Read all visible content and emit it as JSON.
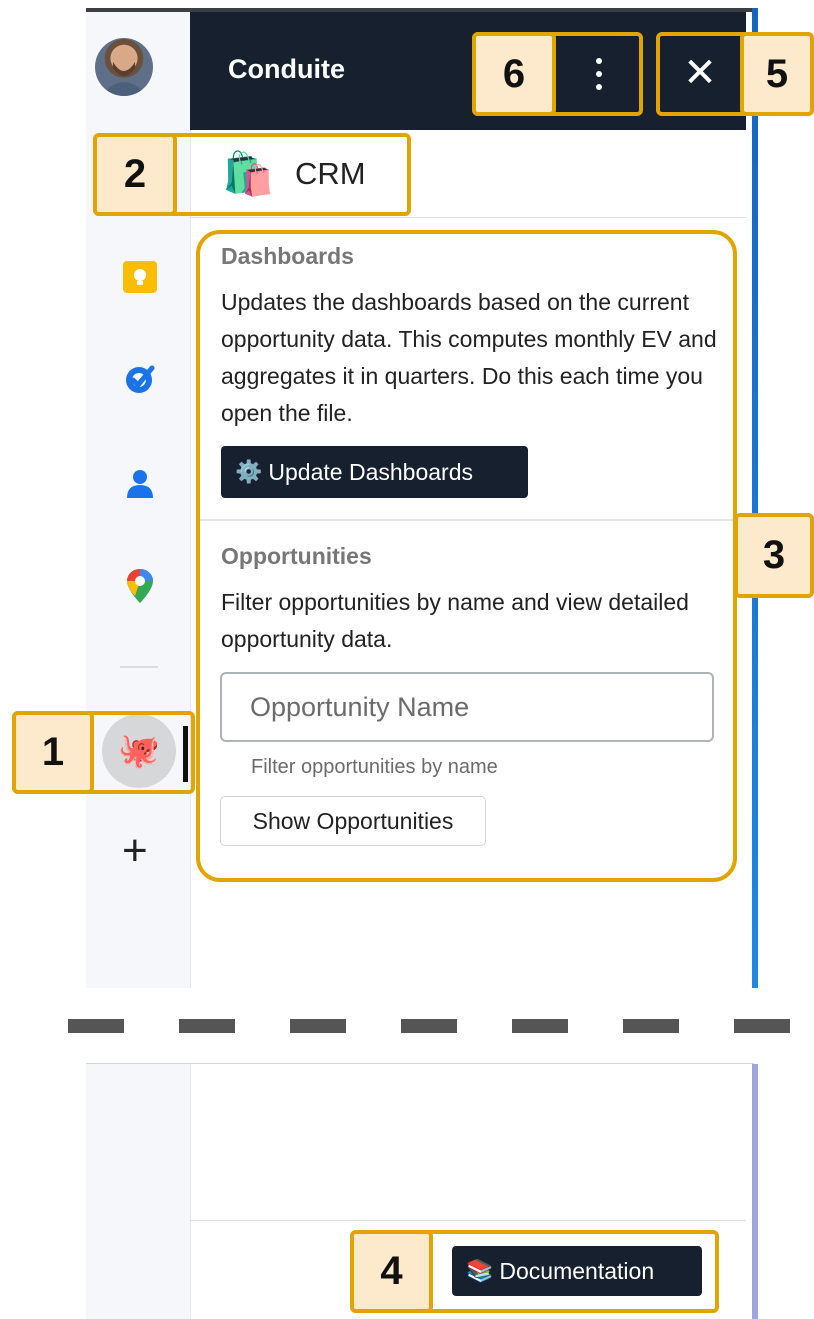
{
  "header": {
    "title": "Conduite",
    "menu_icon": "vertical-ellipsis-icon",
    "close_icon": "close-icon",
    "close_glyph": "✕"
  },
  "rail": {
    "avatar_icon": "user-avatar",
    "items": [
      {
        "name": "keep-icon",
        "color": "#fbbc04"
      },
      {
        "name": "tasks-icon",
        "color": "#1a73e8"
      },
      {
        "name": "contacts-icon",
        "color": "#1a73e8"
      },
      {
        "name": "maps-icon",
        "color": "#34a853"
      }
    ],
    "active_app_glyph": "🐙",
    "add_glyph": "+"
  },
  "addon": {
    "icon_glyph": "🛍️",
    "name": "CRM"
  },
  "dashboards": {
    "title": "Dashboards",
    "description": "Updates the dashboards based on the current opportunity data. This computes monthly EV and aggregates it in quarters. Do this each time you open the file.",
    "button_icon": "⚙️",
    "button_label": "Update Dashboards"
  },
  "opportunities": {
    "title": "Opportunities",
    "description": "Filter opportunities by name and view detailed opportunity data.",
    "input_placeholder": "Opportunity Name",
    "input_hint": "Filter opportunities by name",
    "button_label": "Show Opportunities"
  },
  "footer": {
    "button_icon": "📚",
    "button_label": "Documentation"
  },
  "callouts": {
    "n1": "1",
    "n2": "2",
    "n3": "3",
    "n4": "4",
    "n5": "5",
    "n6": "6",
    "color": "#e2a400",
    "fill": "#fde9cc"
  }
}
